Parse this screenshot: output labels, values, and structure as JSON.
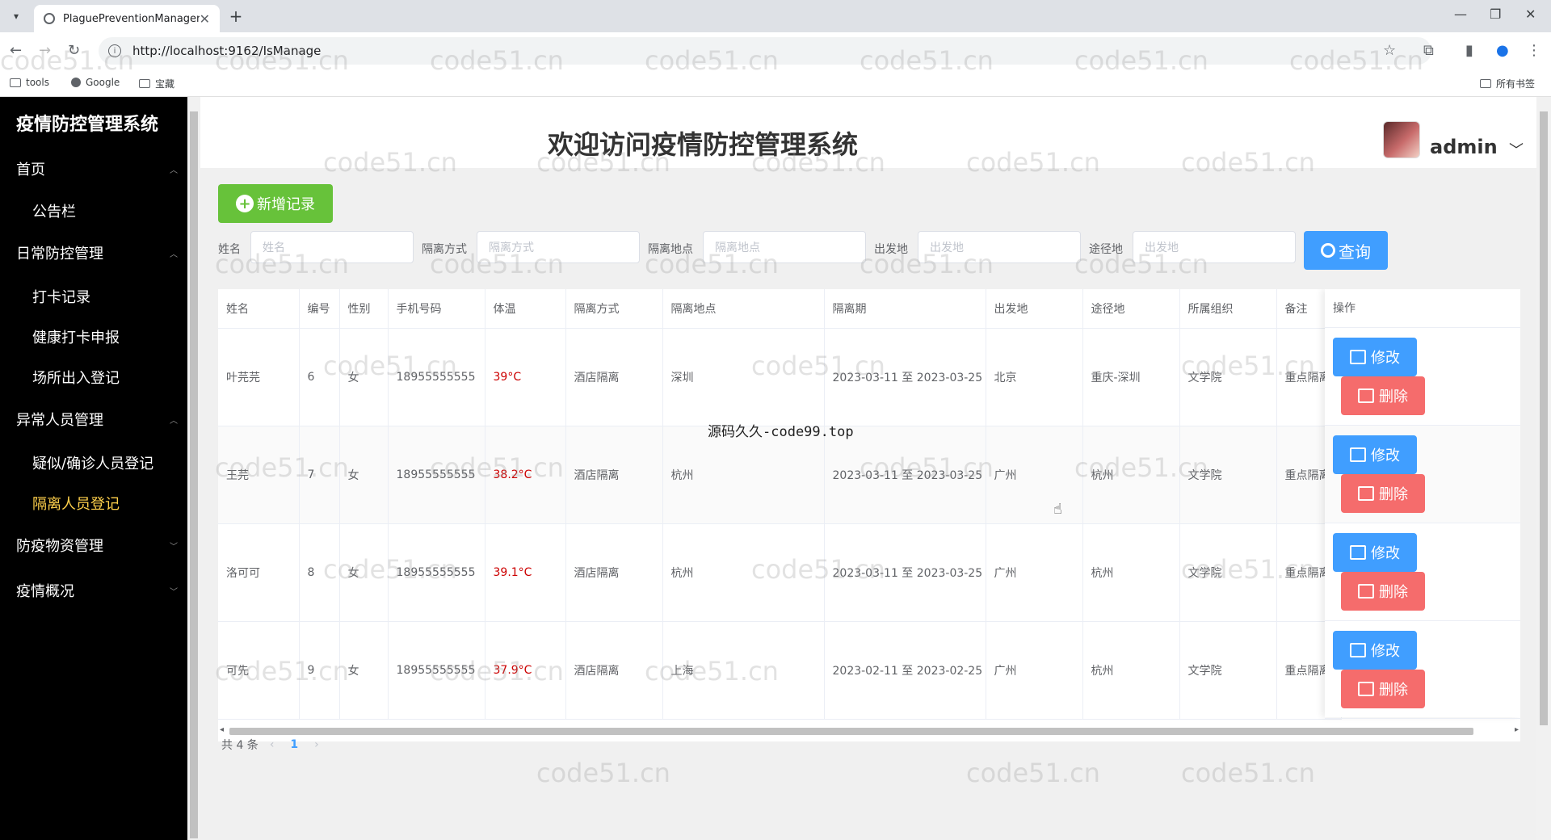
{
  "browser": {
    "tab_title": "PlaguePreventionManagerV...",
    "url": "http://localhost:9162/IsManage",
    "bookmarks": [
      "tools",
      "Google",
      "宝藏"
    ],
    "all_bookmarks": "所有书签"
  },
  "sidebar": {
    "brand": "疫情防控管理系统",
    "items": [
      {
        "label": "首页"
      },
      {
        "label": "公告栏"
      },
      {
        "label": "日常防控管理"
      },
      {
        "label": "打卡记录"
      },
      {
        "label": "健康打卡申报"
      },
      {
        "label": "场所出入登记"
      },
      {
        "label": "异常人员管理"
      },
      {
        "label": "疑似/确诊人员登记"
      },
      {
        "label": "隔离人员登记"
      },
      {
        "label": "防疫物资管理"
      },
      {
        "label": "疫情概况"
      }
    ]
  },
  "header": {
    "title": "欢迎访问疫情防控管理系统",
    "username": "admin"
  },
  "toolbar": {
    "add_label": "新增记录",
    "search_label": "查询"
  },
  "filters": [
    {
      "label": "姓名",
      "placeholder": "姓名"
    },
    {
      "label": "隔离方式",
      "placeholder": "隔离方式"
    },
    {
      "label": "隔离地点",
      "placeholder": "隔离地点"
    },
    {
      "label": "出发地",
      "placeholder": "出发地"
    },
    {
      "label": "途径地",
      "placeholder": "出发地"
    }
  ],
  "table": {
    "columns": [
      "姓名",
      "编号",
      "性别",
      "手机号码",
      "体温",
      "隔离方式",
      "隔离地点",
      "隔离期",
      "出发地",
      "途径地",
      "所属组织",
      "备注",
      "操作"
    ],
    "rows": [
      [
        "叶芫芫",
        "6",
        "女",
        "18955555555",
        "39°C",
        "酒店隔离",
        "深圳",
        "2023-03-11 至 2023-03-25",
        "北京",
        "重庆-深圳",
        "文学院",
        "重点隔离"
      ],
      [
        "王芫",
        "7",
        "女",
        "18955555555",
        "38.2°C",
        "酒店隔离",
        "杭州",
        "2023-03-11 至 2023-03-25",
        "广州",
        "杭州",
        "文学院",
        "重点隔离"
      ],
      [
        "洛可可",
        "8",
        "女",
        "18955555555",
        "39.1°C",
        "酒店隔离",
        "杭州",
        "2023-03-11 至 2023-03-25",
        "广州",
        "杭州",
        "文学院",
        "重点隔离"
      ],
      [
        "可先",
        "9",
        "女",
        "18955555555",
        "37.9°C",
        "酒店隔离",
        "上海",
        "2023-02-11 至 2023-02-25",
        "广州",
        "杭州",
        "文学院",
        "重点隔离"
      ]
    ],
    "edit_label": "修改",
    "delete_label": "删除"
  },
  "pagination": {
    "total_text": "共 4 条",
    "current_page": "1"
  },
  "overlay_text": "源码久久-code99.top",
  "watermark": "code51.cn"
}
